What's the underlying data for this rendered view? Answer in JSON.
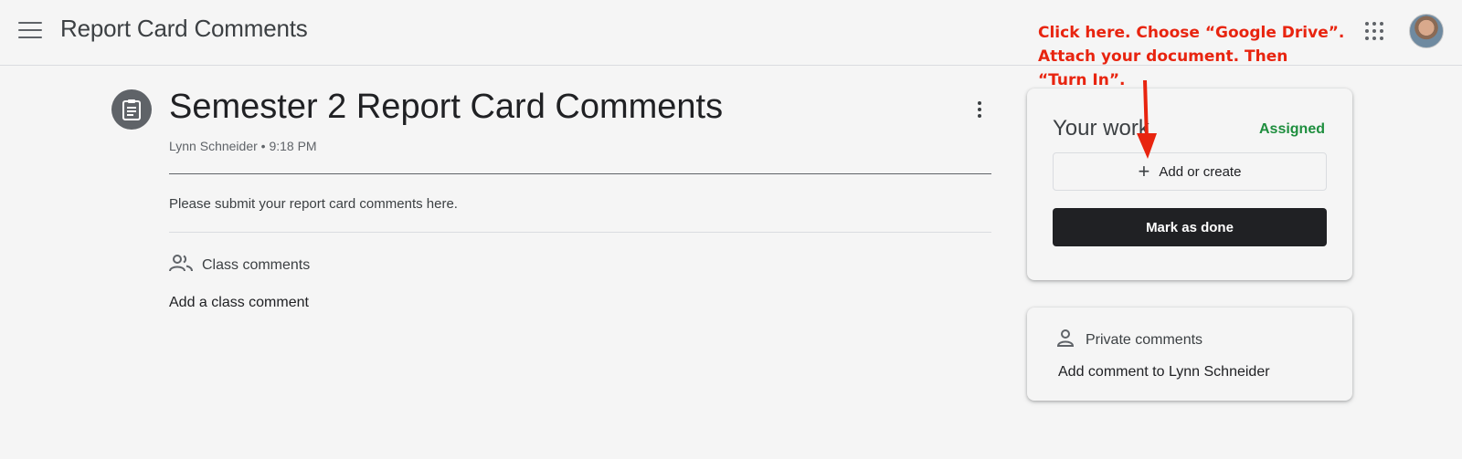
{
  "app": {
    "title": "Report Card Comments"
  },
  "assignment": {
    "title": "Semester 2 Report Card Comments",
    "author": "Lynn Schneider",
    "time": "9:18 PM",
    "meta": "Lynn Schneider • 9:18 PM",
    "instructions": "Please submit your report card comments here."
  },
  "class_comments": {
    "label": "Class comments",
    "add_label": "Add a class comment"
  },
  "your_work": {
    "title": "Your work",
    "status": "Assigned",
    "add_create_label": "Add or create",
    "mark_done_label": "Mark as done"
  },
  "private_comments": {
    "label": "Private comments",
    "add_label": "Add comment to Lynn Schneider"
  },
  "annotation": {
    "line1": "Click here. Choose “Google Drive”.",
    "line2": "Attach your document. Then",
    "line3": "“Turn In”."
  },
  "colors": {
    "background": "#f5f5f5",
    "status_green": "#1e8e3e",
    "primary_button": "#202124",
    "annotation_red": "#e8240f"
  },
  "icons": {
    "menu": "hamburger-menu-icon",
    "assignment": "assignment-icon",
    "more": "more-vert-icon",
    "apps": "apps-grid-icon",
    "people": "people-icon",
    "person": "person-icon",
    "add": "plus-icon"
  }
}
